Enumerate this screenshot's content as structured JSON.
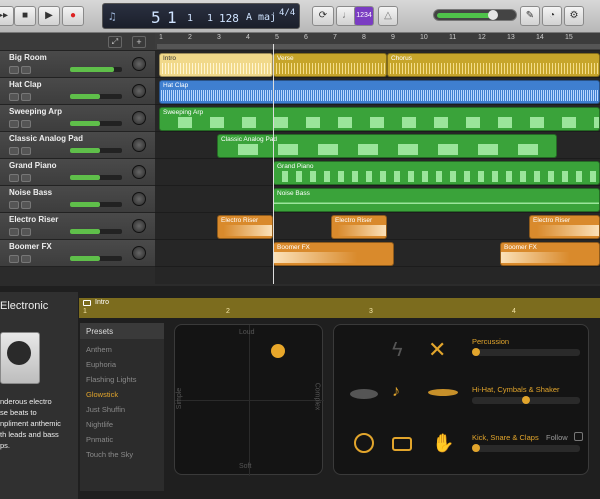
{
  "toolbar": {
    "lcd": {
      "bar": "5",
      "beat": "1",
      "div": "1",
      "tick": "1",
      "tempo": "128",
      "key": "A maj",
      "signature": "4/4"
    },
    "count_in_label": "1234"
  },
  "ruler": {
    "marks": [
      "1",
      "2",
      "3",
      "4",
      "5",
      "6",
      "7",
      "8",
      "9",
      "10",
      "11",
      "12",
      "13",
      "14",
      "15"
    ]
  },
  "tracks": [
    {
      "name": "Big Room"
    },
    {
      "name": "Hat Clap"
    },
    {
      "name": "Sweeping Arp"
    },
    {
      "name": "Classic Analog Pad"
    },
    {
      "name": "Grand Piano"
    },
    {
      "name": "Noise Bass"
    },
    {
      "name": "Electro Riser"
    },
    {
      "name": "Boomer FX"
    }
  ],
  "regions": {
    "intro": "Intro",
    "verse": "Verse",
    "chorus": "Chorus",
    "hatclap": "Hat Clap",
    "sweeping": "Sweeping Arp",
    "pad": "Classic Analog Pad",
    "piano": "Grand Piano",
    "noise": "Noise Bass",
    "riser": "Electro Riser",
    "boomer": "Boomer FX"
  },
  "editor": {
    "title": "Electronic",
    "description_lines": [
      "nderous electro",
      "se beats to",
      "npliment anthemic",
      "th leads and bass",
      "ps."
    ],
    "arrangement_label": "Intro",
    "arrangement_marks": [
      "1",
      "2",
      "3",
      "4"
    ]
  },
  "presets": {
    "header": "Presets",
    "items": [
      "Anthem",
      "Euphoria",
      "Flashing Lights",
      "Glowstick",
      "Just Shuffin",
      "Nightlife",
      "Pnmatic",
      "Touch the Sky"
    ],
    "selected": "Glowstick"
  },
  "xy_pad": {
    "top": "Loud",
    "bottom": "Soft",
    "left": "Simple",
    "right": "Complex"
  },
  "drum_controls": {
    "percussion": "Percussion",
    "hihat": "Hi-Hat, Cymbals & Shaker",
    "kick": "Kick, Snare & Claps",
    "follow": "Follow",
    "percussion_level": 0.0,
    "hihat_level": 0.47,
    "kick_level": 0.0
  },
  "colors": {
    "accent": "#e2a52c",
    "yellow_region": "#c7a52a",
    "blue_region": "#3f7fd0",
    "green_region": "#3aa33a",
    "orange_region": "#d98a2c"
  }
}
